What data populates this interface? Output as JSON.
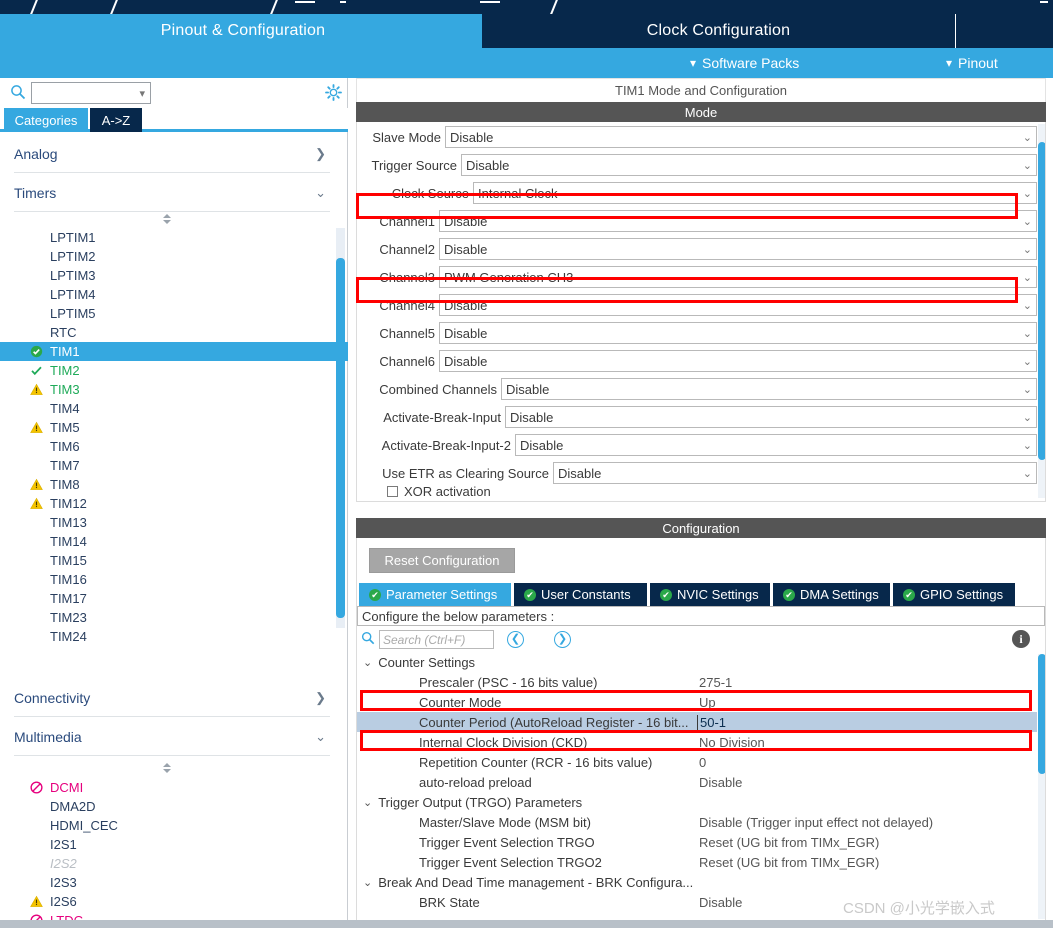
{
  "header": {
    "tabs": [
      {
        "label": "Pinout & Configuration",
        "active": true
      },
      {
        "label": "Clock Configuration",
        "active": false
      }
    ],
    "subitems": [
      {
        "label": "Software Packs",
        "icon": "chevron-down-icon"
      },
      {
        "label": "Pinout",
        "icon": "chevron-down-icon"
      }
    ]
  },
  "sidebar": {
    "search": {
      "value": "",
      "placeholder": "",
      "icon": "search-icon"
    },
    "gear_icon": "gear-icon",
    "view_tabs": [
      {
        "label": "Categories",
        "active": true
      },
      {
        "label": "A->Z",
        "active": false
      }
    ],
    "sections": [
      {
        "label": "Analog",
        "expanded": false,
        "arrow": "chevron-right-icon"
      },
      {
        "label": "Timers",
        "expanded": true,
        "arrow": "chevron-down-icon"
      },
      {
        "label": "Connectivity",
        "expanded": false,
        "arrow": "chevron-right-icon"
      },
      {
        "label": "Multimedia",
        "expanded": true,
        "arrow": "chevron-down-icon"
      }
    ],
    "timers": [
      {
        "label": "LPTIM1",
        "status": "none",
        "selected": false
      },
      {
        "label": "LPTIM2",
        "status": "none",
        "selected": false
      },
      {
        "label": "LPTIM3",
        "status": "none",
        "selected": false
      },
      {
        "label": "LPTIM4",
        "status": "none",
        "selected": false
      },
      {
        "label": "LPTIM5",
        "status": "none",
        "selected": false
      },
      {
        "label": "RTC",
        "status": "none",
        "selected": false
      },
      {
        "label": "TIM1",
        "status": "check-circle-icon",
        "selected": true
      },
      {
        "label": "TIM2",
        "status": "check-icon",
        "selected": false,
        "green": true
      },
      {
        "label": "TIM3",
        "status": "warning-icon",
        "selected": false,
        "green": true
      },
      {
        "label": "TIM4",
        "status": "none",
        "selected": false
      },
      {
        "label": "TIM5",
        "status": "warning-icon",
        "selected": false
      },
      {
        "label": "TIM6",
        "status": "none",
        "selected": false
      },
      {
        "label": "TIM7",
        "status": "none",
        "selected": false
      },
      {
        "label": "TIM8",
        "status": "warning-icon",
        "selected": false
      },
      {
        "label": "TIM12",
        "status": "warning-icon",
        "selected": false
      },
      {
        "label": "TIM13",
        "status": "none",
        "selected": false
      },
      {
        "label": "TIM14",
        "status": "none",
        "selected": false
      },
      {
        "label": "TIM15",
        "status": "none",
        "selected": false
      },
      {
        "label": "TIM16",
        "status": "none",
        "selected": false
      },
      {
        "label": "TIM17",
        "status": "none",
        "selected": false
      },
      {
        "label": "TIM23",
        "status": "none",
        "selected": false
      },
      {
        "label": "TIM24",
        "status": "none",
        "selected": false
      }
    ],
    "multimedia": [
      {
        "label": "DCMI",
        "status": "forbidden-icon",
        "pink": true
      },
      {
        "label": "DMA2D",
        "status": "none"
      },
      {
        "label": "HDMI_CEC",
        "status": "none"
      },
      {
        "label": "I2S1",
        "status": "none"
      },
      {
        "label": "I2S2",
        "status": "none",
        "disabled": true
      },
      {
        "label": "I2S3",
        "status": "none"
      },
      {
        "label": "I2S6",
        "status": "warning-icon"
      },
      {
        "label": "LTDC",
        "status": "forbidden-icon",
        "pink": true
      }
    ]
  },
  "mode_panel": {
    "title": "TIM1 Mode and Configuration",
    "section_label": "Mode",
    "rows": [
      {
        "label": "Slave Mode",
        "value": "Disable",
        "label_w": 80,
        "highlight": false
      },
      {
        "label": "Trigger Source",
        "value": "Disable",
        "label_w": 96,
        "highlight": false
      },
      {
        "label": "Clock Source",
        "value": "Internal Clock",
        "label_w": 108,
        "highlight": true
      },
      {
        "label": "Channel1",
        "value": "Disable",
        "label_w": 74,
        "highlight": false
      },
      {
        "label": "Channel2",
        "value": "Disable",
        "label_w": 74,
        "highlight": false
      },
      {
        "label": "Channel3",
        "value": "PWM Generation CH3",
        "label_w": 74,
        "highlight": true
      },
      {
        "label": "Channel4",
        "value": "Disable",
        "label_w": 74,
        "highlight": false
      },
      {
        "label": "Channel5",
        "value": "Disable",
        "label_w": 74,
        "highlight": false
      },
      {
        "label": "Channel6",
        "value": "Disable",
        "label_w": 74,
        "highlight": false
      },
      {
        "label": "Combined Channels",
        "value": "Disable",
        "label_w": 136,
        "highlight": false
      },
      {
        "label": "Activate-Break-Input",
        "value": "Disable",
        "label_w": 140,
        "highlight": false
      },
      {
        "label": "Activate-Break-Input-2",
        "value": "Disable",
        "label_w": 150,
        "highlight": false
      },
      {
        "label": "Use ETR as Clearing Source",
        "value": "Disable",
        "label_w": 188,
        "highlight": false
      }
    ],
    "checkbox_row": {
      "label": "XOR activation",
      "checked": false
    }
  },
  "config_panel": {
    "section_label": "Configuration",
    "reset_button": "Reset Configuration",
    "tabs": [
      {
        "label": "Parameter Settings",
        "active": true,
        "icon": "check-circle-icon"
      },
      {
        "label": "User Constants",
        "active": false,
        "icon": "check-circle-icon"
      },
      {
        "label": "NVIC Settings",
        "active": false,
        "icon": "check-circle-icon"
      },
      {
        "label": "DMA Settings",
        "active": false,
        "icon": "check-circle-icon"
      },
      {
        "label": "GPIO Settings",
        "active": false,
        "icon": "check-circle-icon"
      }
    ],
    "note": "Configure the below parameters :",
    "search": {
      "placeholder": "Search (Ctrl+F)",
      "value": "",
      "icon": "search-icon"
    },
    "nav_prev_icon": "chevron-left-circle-icon",
    "nav_next_icon": "chevron-right-circle-icon",
    "info_icon": "info-icon",
    "parameters": [
      {
        "type": "group",
        "name": "Counter Settings",
        "value": "",
        "arrow": "chevron-down-icon"
      },
      {
        "type": "param",
        "name": "Prescaler (PSC - 16 bits value)",
        "value": "275-1",
        "highlight": true
      },
      {
        "type": "param",
        "name": "Counter Mode",
        "value": "Up"
      },
      {
        "type": "param",
        "name": "Counter Period (AutoReload Register - 16 bit...",
        "value": "50-1",
        "highlight": true,
        "selected": true
      },
      {
        "type": "param",
        "name": "Internal Clock Division (CKD)",
        "value": "No Division"
      },
      {
        "type": "param",
        "name": "Repetition Counter (RCR - 16 bits value)",
        "value": "0"
      },
      {
        "type": "param",
        "name": "auto-reload preload",
        "value": "Disable"
      },
      {
        "type": "group",
        "name": "Trigger Output (TRGO) Parameters",
        "value": "",
        "arrow": "chevron-down-icon"
      },
      {
        "type": "param",
        "name": "Master/Slave Mode (MSM bit)",
        "value": "Disable (Trigger input effect not delayed)"
      },
      {
        "type": "param",
        "name": "Trigger Event Selection TRGO",
        "value": "Reset (UG bit from TIMx_EGR)"
      },
      {
        "type": "param",
        "name": "Trigger Event Selection TRGO2",
        "value": "Reset (UG bit from TIMx_EGR)"
      },
      {
        "type": "group",
        "name": "Break And Dead Time management - BRK Configura...",
        "value": "",
        "arrow": "chevron-down-icon"
      },
      {
        "type": "param",
        "name": "BRK State",
        "value": "Disable"
      }
    ]
  },
  "watermark": "CSDN @小光学嵌入式",
  "colors": {
    "accent_blue": "#35a8e0",
    "dark_navy": "#07284b",
    "header_gray": "#555555",
    "highlight_red": "#ff0000",
    "row_selected": "#b9cde2",
    "warning_yellow": "#f5c400",
    "ok_green": "#1faa59",
    "forbidden_pink": "#e6007e"
  }
}
